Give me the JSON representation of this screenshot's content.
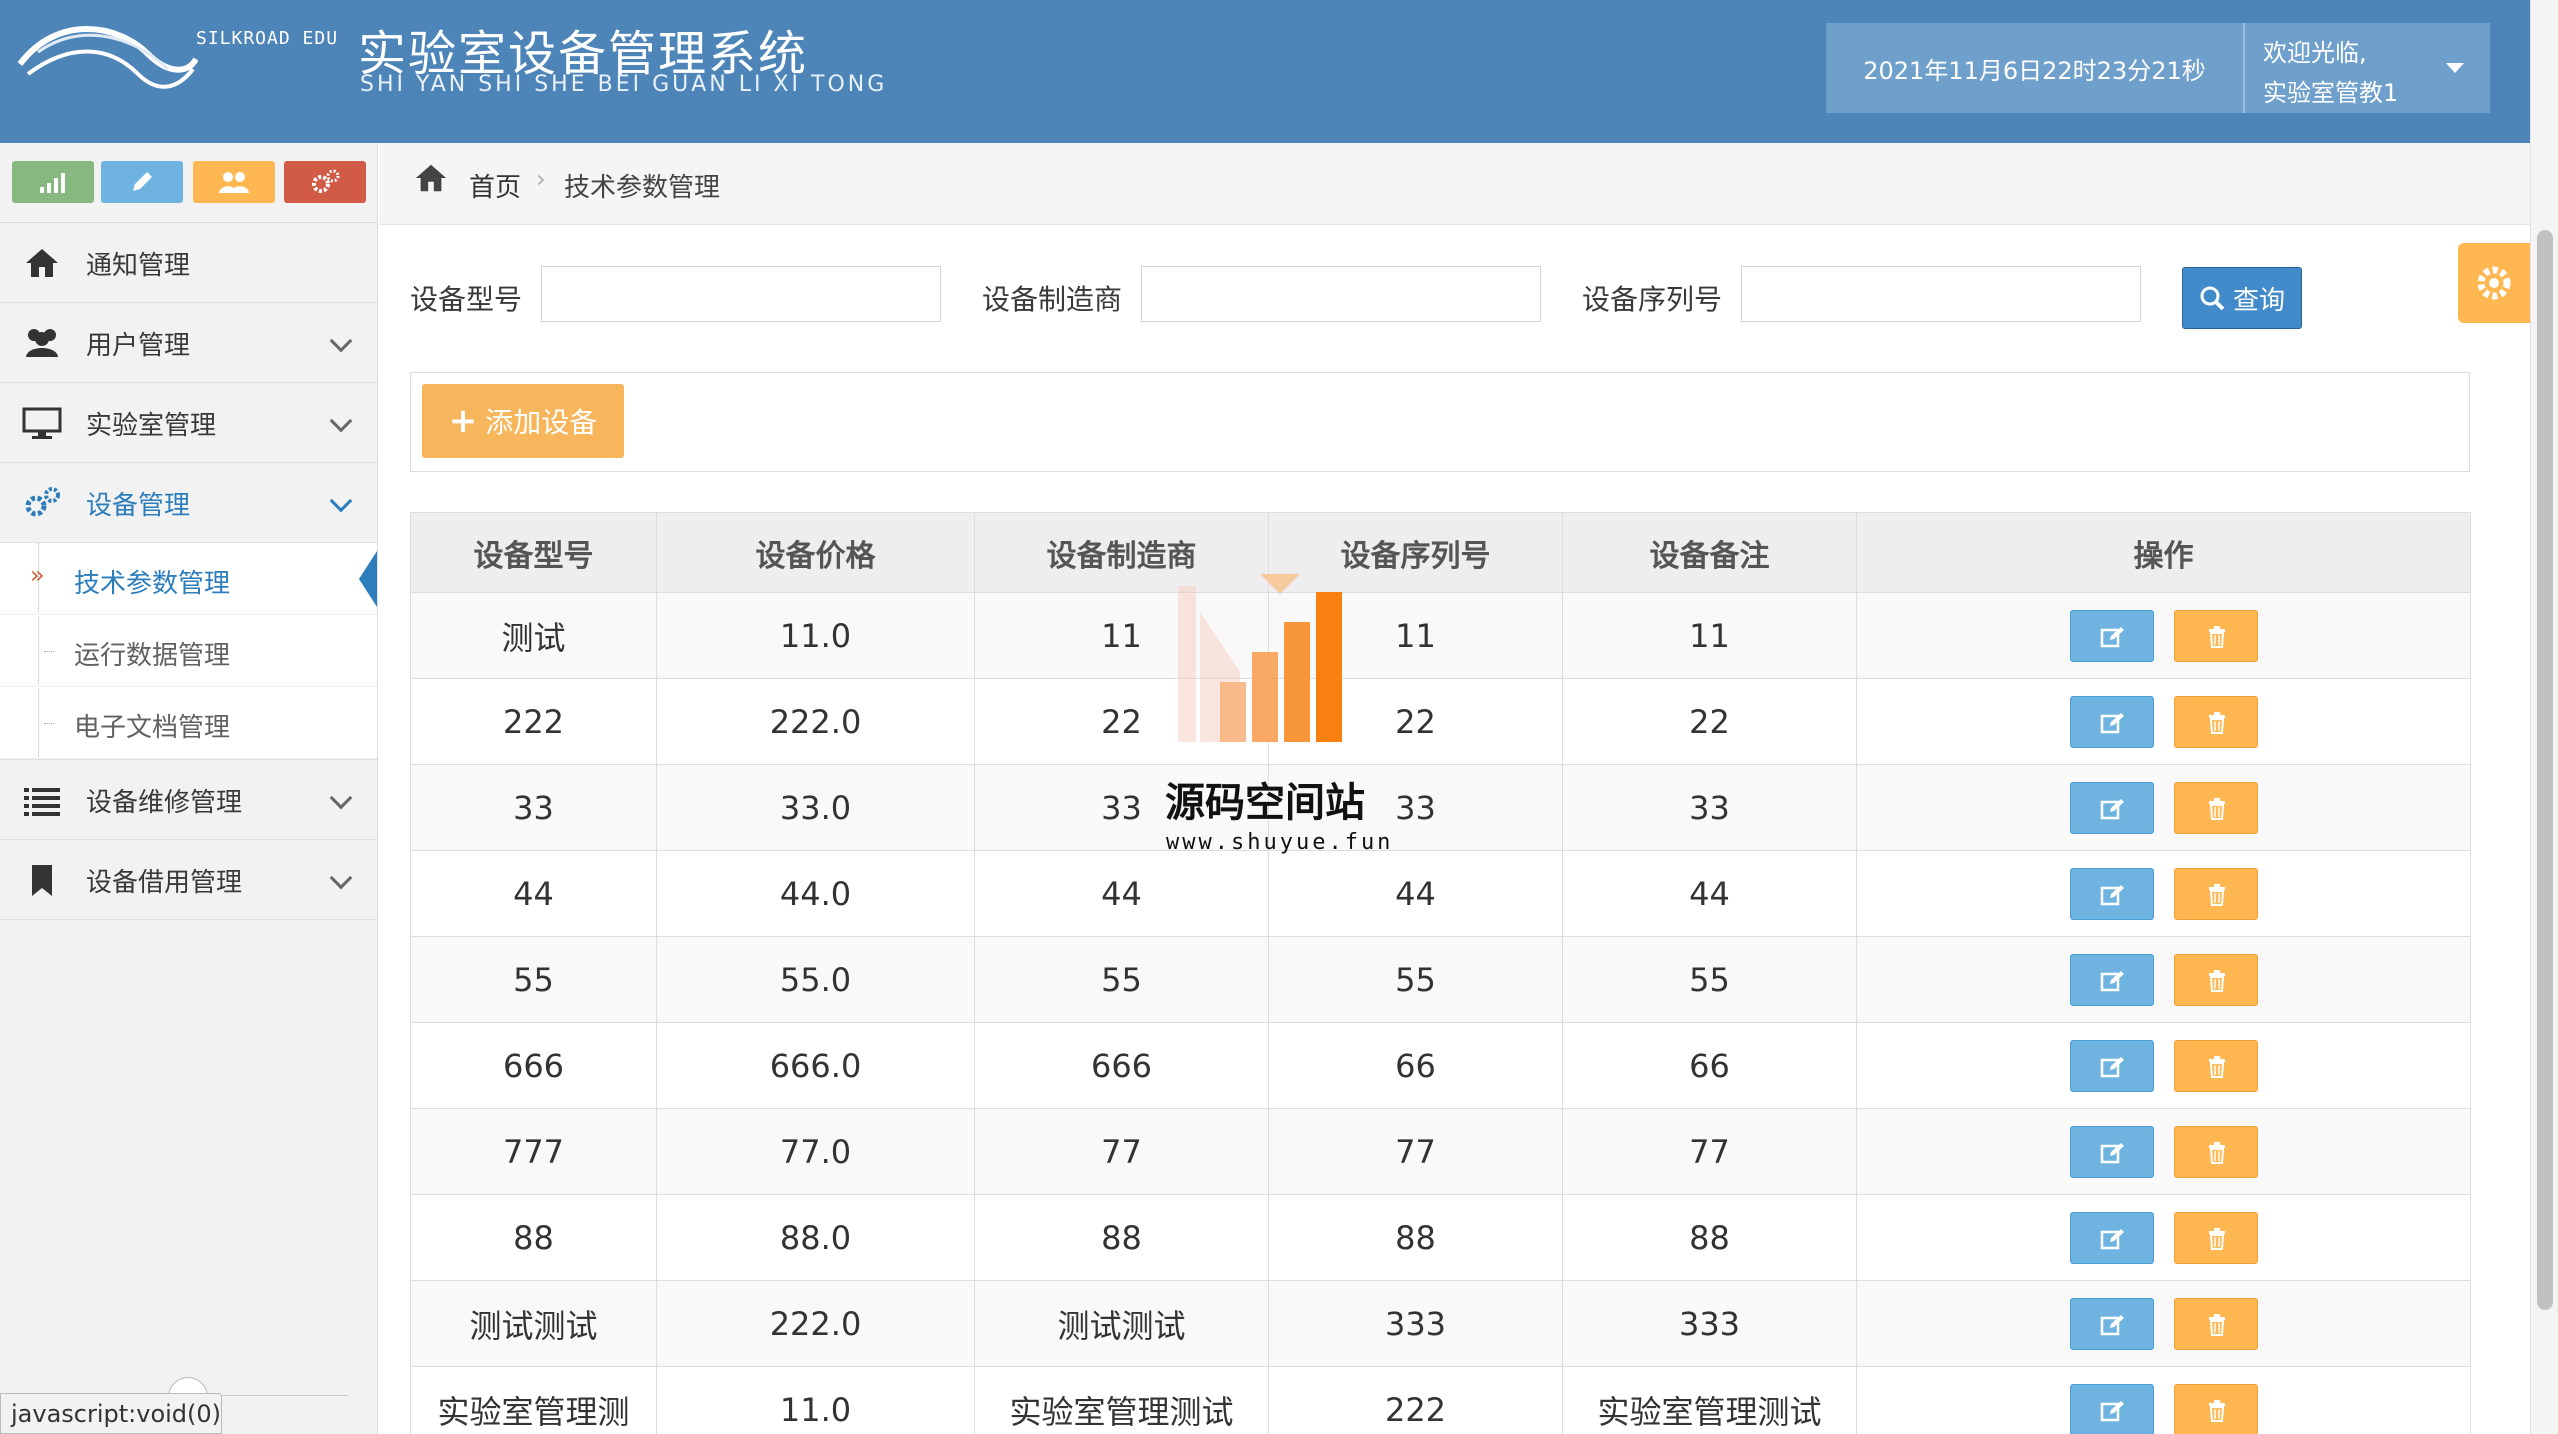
{
  "header": {
    "brand": "SILKROAD EDU",
    "title": "实验室设备管理系统",
    "pinyin": "SHI YAN SHI SHE BEI GUAN LI XI TONG",
    "datetime": "2021年11月6日22时23分21秒",
    "welcome": "欢迎光临,",
    "username": "实验室管教1"
  },
  "sidebar": {
    "shortcuts": [
      "signal-icon",
      "pencil-icon",
      "users-icon",
      "cogs-icon"
    ],
    "items": [
      {
        "label": "通知管理",
        "icon": "home-icon"
      },
      {
        "label": "用户管理",
        "icon": "users-icon"
      },
      {
        "label": "实验室管理",
        "icon": "desktop-icon"
      },
      {
        "label": "设备管理",
        "icon": "cogs-icon"
      },
      {
        "label": "设备维修管理",
        "icon": "list-icon"
      },
      {
        "label": "设备借用管理",
        "icon": "bookmark-icon"
      }
    ],
    "sub_items": [
      {
        "label": "技术参数管理"
      },
      {
        "label": "运行数据管理"
      },
      {
        "label": "电子文档管理"
      }
    ]
  },
  "breadcrumb": {
    "home": "首页",
    "current": "技术参数管理"
  },
  "search": {
    "model_label": "设备型号",
    "model_value": "",
    "maker_label": "设备制造商",
    "maker_value": "",
    "serial_label": "设备序列号",
    "serial_value": "",
    "query_label": "查询"
  },
  "toolbar": {
    "add_label": "添加设备"
  },
  "table": {
    "headers": [
      "设备型号",
      "设备价格",
      "设备制造商",
      "设备序列号",
      "设备备注",
      "操作"
    ],
    "rows": [
      [
        "测试",
        "11.0",
        "11",
        "11",
        "11"
      ],
      [
        "222",
        "222.0",
        "22",
        "22",
        "22"
      ],
      [
        "33",
        "33.0",
        "33",
        "33",
        "33"
      ],
      [
        "44",
        "44.0",
        "44",
        "44",
        "44"
      ],
      [
        "55",
        "55.0",
        "55",
        "55",
        "55"
      ],
      [
        "666",
        "666.0",
        "666",
        "66",
        "66"
      ],
      [
        "777",
        "77.0",
        "77",
        "77",
        "77"
      ],
      [
        "88",
        "88.0",
        "88",
        "88",
        "88"
      ],
      [
        "测试测试",
        "222.0",
        "测试测试",
        "333",
        "333"
      ],
      [
        "实验室管理测",
        "11.0",
        "实验室管理测试",
        "222",
        "实验室管理测试"
      ]
    ]
  },
  "watermark": {
    "text": "源码空间站",
    "url": "www.shuyue.fun"
  },
  "status_bar": "javascript:void(0)",
  "colors": {
    "header_bg": "#4e85b8",
    "primary": "#428bca",
    "warning": "#ffb752",
    "info": "#6fb3e0",
    "success": "#87b87f",
    "danger": "#d15b47",
    "active_link": "#2b7dbc"
  }
}
